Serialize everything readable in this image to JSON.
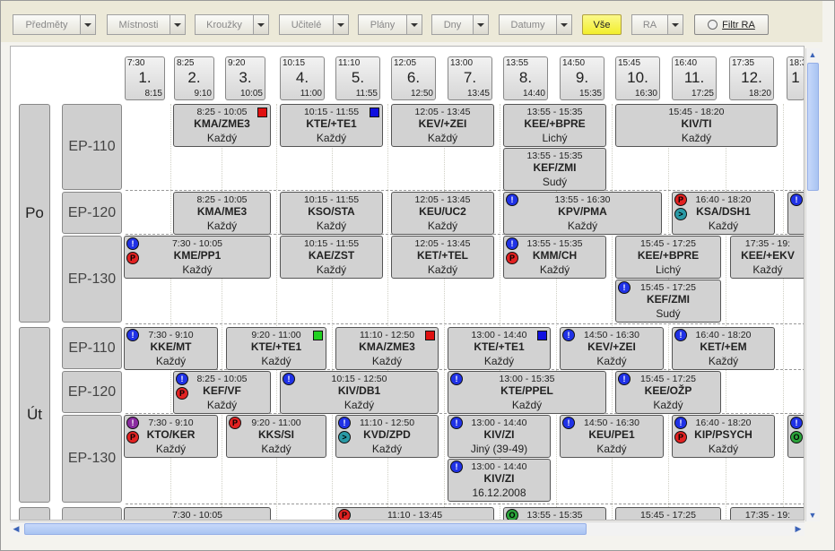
{
  "toolbar": {
    "dropdowns": [
      "Předměty",
      "Místnosti",
      "Kroužky",
      "Učitelé",
      "Plány",
      "Dny",
      "Datumy"
    ],
    "all_button": "Vše",
    "ra_dropdown": "RA",
    "filter_button": "Filtr RA"
  },
  "slots": [
    {
      "start": "7:30",
      "num": "1.",
      "end": "8:15"
    },
    {
      "start": "8:25",
      "num": "2.",
      "end": "9:10"
    },
    {
      "start": "9:20",
      "num": "3.",
      "end": "10:05"
    },
    {
      "start": "10:15",
      "num": "4.",
      "end": "11:00"
    },
    {
      "start": "11:10",
      "num": "5.",
      "end": "11:55"
    },
    {
      "start": "12:05",
      "num": "6.",
      "end": "12:50"
    },
    {
      "start": "13:00",
      "num": "7.",
      "end": "13:45"
    },
    {
      "start": "13:55",
      "num": "8.",
      "end": "14:40"
    },
    {
      "start": "14:50",
      "num": "9.",
      "end": "15:35"
    },
    {
      "start": "15:45",
      "num": "10.",
      "end": "16:30"
    },
    {
      "start": "16:40",
      "num": "11.",
      "end": "17:25"
    },
    {
      "start": "17:35",
      "num": "12.",
      "end": "18:20"
    },
    {
      "start": "18:3",
      "num": "1",
      "end": ""
    }
  ],
  "days": [
    "Po",
    "Út"
  ],
  "rooms": {
    "po": [
      "EP-110",
      "EP-120",
      "EP-130"
    ],
    "ut": [
      "EP-110",
      "EP-120",
      "EP-130"
    ]
  },
  "colors": {
    "blue": "#1010e0",
    "red": "#e01010",
    "green": "#20d020"
  },
  "events": [
    {
      "time": "8:25 - 10:05",
      "subject": "KMA/ZME3",
      "week": "Každý",
      "square": "red"
    },
    {
      "time": "10:15 - 11:55",
      "subject": "KTE/+TE1",
      "week": "Každý",
      "square": "blue"
    },
    {
      "time": "12:05 - 13:45",
      "subject": "KEV/+ZEI",
      "week": "Každý"
    },
    {
      "time": "13:55 - 15:35",
      "subject": "KEE/+BPRE",
      "week": "Lichý"
    },
    {
      "time": "15:45 - 18:20",
      "subject": "KIV/TI",
      "week": "Každý"
    },
    {
      "time": "13:55 - 15:35",
      "subject": "KEF/ZMI",
      "week": "Sudý"
    },
    {
      "time": "8:25 - 10:05",
      "subject": "KMA/ME3",
      "week": "Každý"
    },
    {
      "time": "10:15 - 11:55",
      "subject": "KSO/STA",
      "week": "Každý"
    },
    {
      "time": "12:05 - 13:45",
      "subject": "KEU/UC2",
      "week": "Každý"
    },
    {
      "time": "13:55 - 16:30",
      "subject": "KPV/PMA",
      "week": "Každý",
      "icons": [
        [
          "ex",
          "!"
        ]
      ]
    },
    {
      "time": "16:40 - 18:20",
      "subject": "KSA/DSH1",
      "week": "Každý",
      "icons": [
        [
          "pp",
          "P"
        ],
        [
          "tt",
          ">"
        ]
      ]
    },
    {
      "time": "",
      "subject": "",
      "week": "",
      "icons": [
        [
          "ex",
          "!"
        ]
      ]
    },
    {
      "time": "7:30 - 10:05",
      "subject": "KME/PP1",
      "week": "Každý",
      "icons": [
        [
          "ex",
          "!"
        ],
        [
          "pp",
          "P"
        ]
      ]
    },
    {
      "time": "10:15 - 11:55",
      "subject": "KAE/ZST",
      "week": "Každý"
    },
    {
      "time": "12:05 - 13:45",
      "subject": "KET/+TEL",
      "week": "Každý"
    },
    {
      "time": "13:55 - 15:35",
      "subject": "KMM/CH",
      "week": "Každý",
      "icons": [
        [
          "ex",
          "!"
        ],
        [
          "pp",
          "P"
        ]
      ]
    },
    {
      "time": "15:45 - 17:25",
      "subject": "KEE/+BPRE",
      "week": "Lichý"
    },
    {
      "time": "17:35 - 19:",
      "subject": "KEE/+EKV",
      "week": "Každý"
    },
    {
      "time": "15:45 - 17:25",
      "subject": "KEF/ZMI",
      "week": "Sudý",
      "icons": [
        [
          "ex",
          "!"
        ]
      ]
    },
    {
      "time": "7:30 - 9:10",
      "subject": "KKE/MT",
      "week": "Každý",
      "icons": [
        [
          "ex",
          "!"
        ]
      ]
    },
    {
      "time": "9:20 - 11:00",
      "subject": "KTE/+TE1",
      "week": "Každý",
      "square": "green"
    },
    {
      "time": "11:10 - 12:50",
      "subject": "KMA/ZME3",
      "week": "Každý",
      "square": "red"
    },
    {
      "time": "13:00 - 14:40",
      "subject": "KTE/+TE1",
      "week": "Každý",
      "square": "blue"
    },
    {
      "time": "14:50 - 16:30",
      "subject": "KEV/+ZEI",
      "week": "Každý",
      "icons": [
        [
          "ex",
          "!"
        ]
      ]
    },
    {
      "time": "16:40 - 18:20",
      "subject": "KET/+EM",
      "week": "Každý",
      "icons": [
        [
          "ex",
          "!"
        ]
      ]
    },
    {
      "time": "8:25 - 10:05",
      "subject": "KEF/VF",
      "week": "Každý",
      "icons": [
        [
          "ex",
          "!"
        ],
        [
          "pp",
          "P"
        ]
      ]
    },
    {
      "time": "10:15 - 12:50",
      "subject": "KIV/DB1",
      "week": "Každý",
      "icons": [
        [
          "ex",
          "!"
        ]
      ]
    },
    {
      "time": "13:00 - 15:35",
      "subject": "KTE/PPEL",
      "week": "Každý",
      "icons": [
        [
          "ex",
          "!"
        ]
      ]
    },
    {
      "time": "15:45 - 17:25",
      "subject": "KEE/OŽP",
      "week": "Každý",
      "icons": [
        [
          "ex",
          "!"
        ]
      ]
    },
    {
      "time": "7:30 - 9:10",
      "subject": "KTO/KER",
      "week": "Každý",
      "icons": [
        [
          "pu",
          "!"
        ],
        [
          "pp",
          "P"
        ]
      ]
    },
    {
      "time": "9:20 - 11:00",
      "subject": "KKS/SI",
      "week": "Každý",
      "icons": [
        [
          "pp",
          "P"
        ]
      ]
    },
    {
      "time": "11:10 - 12:50",
      "subject": "KVD/ZPD",
      "week": "Každý",
      "icons": [
        [
          "ex",
          "!"
        ],
        [
          "tt",
          ">"
        ]
      ]
    },
    {
      "time": "13:00 - 14:40",
      "subject": "KIV/ZI",
      "week": "Jiný (39-49)",
      "icons": [
        [
          "ex",
          "!"
        ]
      ]
    },
    {
      "time": "14:50 - 16:30",
      "subject": "KEU/PE1",
      "week": "Každý",
      "icons": [
        [
          "ex",
          "!"
        ]
      ]
    },
    {
      "time": "16:40 - 18:20",
      "subject": "KIP/PSYCH",
      "week": "Každý",
      "icons": [
        [
          "ex",
          "!"
        ],
        [
          "pp",
          "P"
        ]
      ]
    },
    {
      "time": "",
      "subject": "",
      "week": "",
      "icons": [
        [
          "ex",
          "!"
        ],
        [
          "gg",
          "O"
        ]
      ]
    },
    {
      "time": "13:00 - 14:40",
      "subject": "KIV/ZI",
      "week": "16.12.2008",
      "icons": [
        [
          "ex",
          "!"
        ]
      ]
    },
    {
      "time": "7:30 - 10:05",
      "subject": "",
      "week": ""
    },
    {
      "time": "11:10 - 13:45",
      "subject": "",
      "week": "",
      "icons": [
        [
          "pp",
          "P"
        ]
      ]
    },
    {
      "time": "13:55 - 15:35",
      "subject": "",
      "week": "",
      "icons": [
        [
          "gg",
          "O"
        ]
      ]
    },
    {
      "time": "15:45 - 17:25",
      "subject": "",
      "week": ""
    },
    {
      "time": "17:35 - 19:",
      "subject": "",
      "week": ""
    }
  ]
}
